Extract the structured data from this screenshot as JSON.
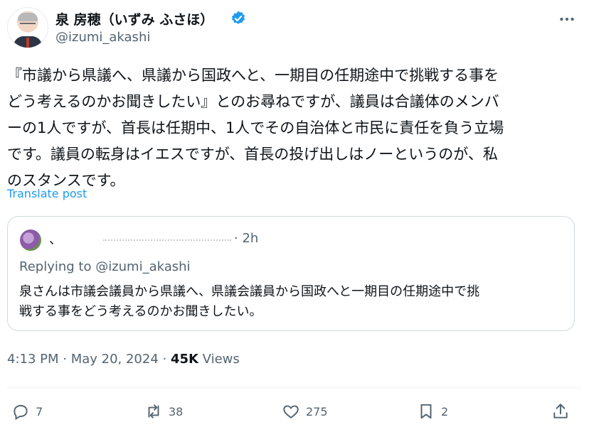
{
  "author": {
    "display_name": "泉 房穂（いずみ ふさほ）",
    "handle": "@izumi_akashi"
  },
  "post": {
    "text": "『市議から県議へ、県議から国政へと、一期目の任期途中で挑戦する事を\nどう考えるのかお聞きしたい』とのお尋ねですが、議員は合議体のメンバ\nーの1人ですが、首長は任期中、1人でその自治体と市民に責任を負う立場\nです。議員の転身はイエスですが、首長の投げ出しはノーというのが、私\nのスタンスです。",
    "translate_label": "Translate post",
    "timestamp": "4:13 PM · May 20, 2024 · ",
    "views_count": "45K",
    "views_label": " Views"
  },
  "quoted_post": {
    "name": "、",
    "time": "· 2h",
    "reply_line": "Replying to @izumi_akashi",
    "text": "泉さんは市議会議員から県議へ、県議会議員から国政へと一期目の任期途中で挑\n戦する事をどう考えるのかお聞きしたい。"
  },
  "actions": {
    "replies": "7",
    "reposts": "38",
    "likes": "275",
    "bookmarks": "2"
  },
  "colors": {
    "accent": "#1d9bf0",
    "secondary_text": "#536471",
    "border": "#cfd9de"
  },
  "icons": [
    "more-icon",
    "verified-icon",
    "reply-icon",
    "repost-icon",
    "like-icon",
    "bookmark-icon",
    "share-icon"
  ]
}
